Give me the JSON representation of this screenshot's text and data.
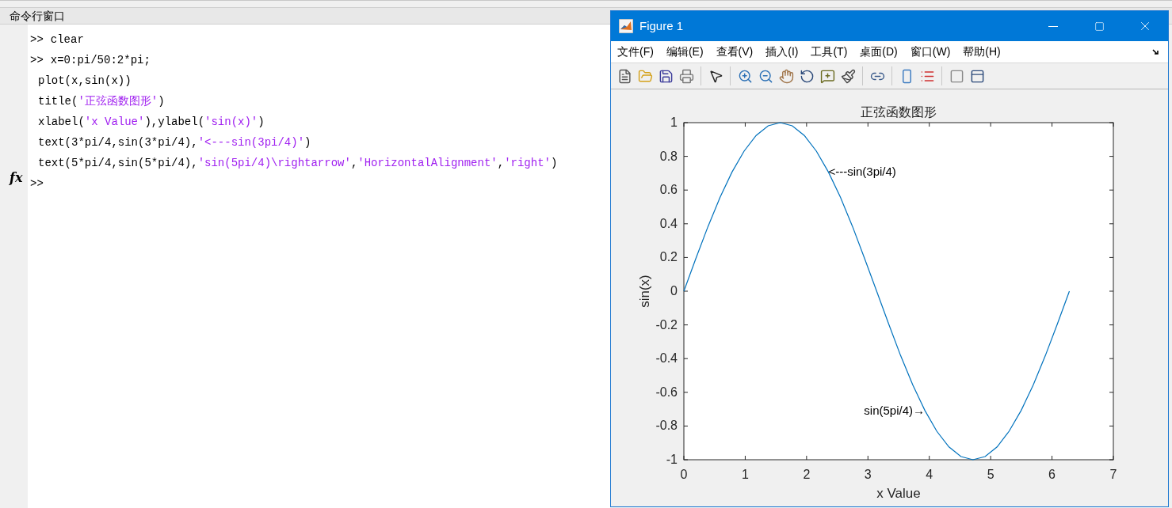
{
  "command_window": {
    "title": "命令行窗口",
    "lines": [
      {
        "prompt": ">>",
        "segments": [
          {
            "kind": "code",
            "text": "clear"
          }
        ]
      },
      {
        "prompt": ">>",
        "segments": [
          {
            "kind": "code",
            "text": "x=0:pi/50:2*pi;"
          }
        ]
      },
      {
        "segments": [
          {
            "kind": "code",
            "text": "plot(x,sin(x))"
          }
        ]
      },
      {
        "segments": [
          {
            "kind": "code",
            "text": "title("
          },
          {
            "kind": "string",
            "text": "'正弦函数图形'"
          },
          {
            "kind": "code",
            "text": ")"
          }
        ]
      },
      {
        "segments": [
          {
            "kind": "code",
            "text": "xlabel("
          },
          {
            "kind": "string",
            "text": "'x Value'"
          },
          {
            "kind": "code",
            "text": "),ylabel("
          },
          {
            "kind": "string",
            "text": "'sin(x)'"
          },
          {
            "kind": "code",
            "text": ")"
          }
        ]
      },
      {
        "segments": [
          {
            "kind": "code",
            "text": "text(3*pi/4,sin(3*pi/4),"
          },
          {
            "kind": "string",
            "text": "'<---sin(3pi/4)'"
          },
          {
            "kind": "code",
            "text": ")"
          }
        ]
      },
      {
        "segments": [
          {
            "kind": "code",
            "text": "text(5*pi/4,sin(5*pi/4),"
          },
          {
            "kind": "string",
            "text": "'sin(5pi/4)\\rightarrow'"
          },
          {
            "kind": "code",
            "text": ","
          },
          {
            "kind": "string",
            "text": "'HorizontalAlignment'"
          },
          {
            "kind": "code",
            "text": ","
          },
          {
            "kind": "string",
            "text": "'right'"
          },
          {
            "kind": "code",
            "text": ")"
          }
        ]
      }
    ],
    "input_prompt": ">>",
    "function_label": "fx"
  },
  "figure": {
    "title": "Figure 1",
    "menu": [
      "文件(F)",
      "编辑(E)",
      "查看(V)",
      "插入(I)",
      "工具(T)",
      "桌面(D)",
      "窗口(W)",
      "帮助(H)"
    ],
    "toolbar": [
      {
        "kind": "new"
      },
      {
        "kind": "open"
      },
      {
        "kind": "save"
      },
      {
        "kind": "print"
      },
      {
        "kind": "sep"
      },
      {
        "kind": "pointer"
      },
      {
        "kind": "sep"
      },
      {
        "kind": "zoom-in"
      },
      {
        "kind": "zoom-out"
      },
      {
        "kind": "pan"
      },
      {
        "kind": "rotate"
      },
      {
        "kind": "datatip"
      },
      {
        "kind": "brush"
      },
      {
        "kind": "sep"
      },
      {
        "kind": "link"
      },
      {
        "kind": "sep"
      },
      {
        "kind": "colorbar"
      },
      {
        "kind": "legend"
      },
      {
        "kind": "sep"
      },
      {
        "kind": "hide"
      },
      {
        "kind": "show"
      }
    ],
    "chart_data": {
      "type": "line",
      "title": "正弦函数图形",
      "xlabel": "x Value",
      "ylabel": "sin(x)",
      "x": [
        0,
        0.196,
        0.393,
        0.589,
        0.785,
        0.982,
        1.178,
        1.374,
        1.571,
        1.767,
        1.963,
        2.16,
        2.356,
        2.553,
        2.749,
        2.945,
        3.142,
        3.338,
        3.534,
        3.731,
        3.927,
        4.123,
        4.32,
        4.516,
        4.712,
        4.909,
        5.105,
        5.301,
        5.498,
        5.694,
        5.89,
        6.087,
        6.283
      ],
      "series": [
        {
          "color": "#0072bd",
          "values": [
            0,
            0.195,
            0.383,
            0.556,
            0.707,
            0.831,
            0.924,
            0.981,
            1,
            0.981,
            0.924,
            0.831,
            0.707,
            0.556,
            0.383,
            0.195,
            0,
            -0.195,
            -0.383,
            -0.556,
            -0.707,
            -0.831,
            -0.924,
            -0.981,
            -1,
            -0.981,
            -0.924,
            -0.831,
            -0.707,
            -0.556,
            -0.383,
            -0.195,
            0
          ]
        }
      ],
      "xlim": [
        0,
        7
      ],
      "ylim": [
        -1,
        1
      ],
      "xticks": [
        0,
        1,
        2,
        3,
        4,
        5,
        6,
        7
      ],
      "yticks": [
        -1,
        -0.8,
        -0.6,
        -0.4,
        -0.2,
        0,
        0.2,
        0.4,
        0.6,
        0.8,
        1
      ],
      "annotations": [
        {
          "x": 2.356,
          "y": 0.707,
          "text": "<---sin(3pi/4)"
        },
        {
          "x": 3.927,
          "y": -0.707,
          "text": "sin(5pi/4)→"
        }
      ]
    }
  }
}
